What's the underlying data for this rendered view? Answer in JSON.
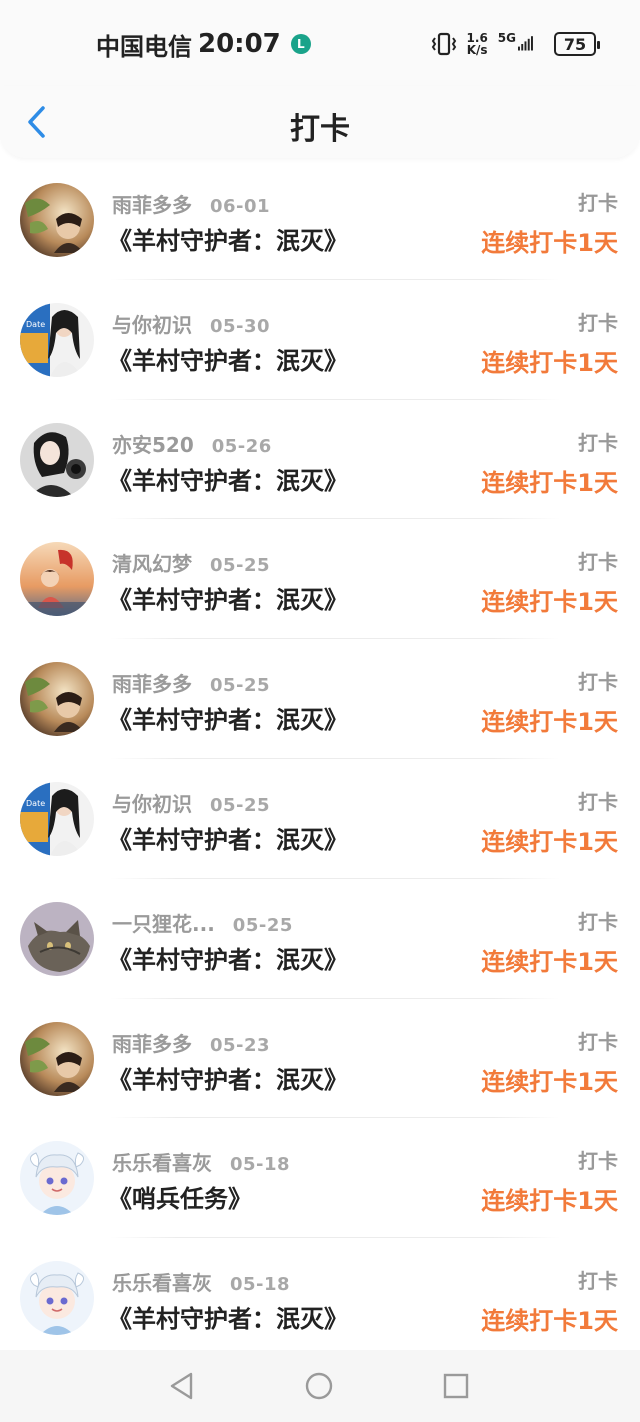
{
  "status_bar": {
    "carrier": "中国电信",
    "time": "20:07",
    "indicator": "L",
    "speed_value": "1.6",
    "speed_unit": "K/s",
    "network": "5G",
    "battery": "75"
  },
  "header": {
    "title": "打卡",
    "back_icon": "chevron-left-icon"
  },
  "colors": {
    "accent": "#f27a3a",
    "back": "#2e8ce6",
    "indicator": "#1aa38a"
  },
  "list": [
    {
      "name": "雨菲多多",
      "date": "06-01",
      "book": "《羊村守护者：泯灭》",
      "label": "打卡",
      "streak": "连续打卡1天",
      "avatar": "avatar-1"
    },
    {
      "name": "与你初识",
      "date": "05-30",
      "book": "《羊村守护者：泯灭》",
      "label": "打卡",
      "streak": "连续打卡1天",
      "avatar": "avatar-2"
    },
    {
      "name": "亦安520",
      "date": "05-26",
      "book": "《羊村守护者：泯灭》",
      "label": "打卡",
      "streak": "连续打卡1天",
      "avatar": "avatar-3"
    },
    {
      "name": "清风幻梦",
      "date": "05-25",
      "book": "《羊村守护者：泯灭》",
      "label": "打卡",
      "streak": "连续打卡1天",
      "avatar": "avatar-4"
    },
    {
      "name": "雨菲多多",
      "date": "05-25",
      "book": "《羊村守护者：泯灭》",
      "label": "打卡",
      "streak": "连续打卡1天",
      "avatar": "avatar-1"
    },
    {
      "name": "与你初识",
      "date": "05-25",
      "book": "《羊村守护者：泯灭》",
      "label": "打卡",
      "streak": "连续打卡1天",
      "avatar": "avatar-2"
    },
    {
      "name": "一只狸花...",
      "date": "05-25",
      "book": "《羊村守护者：泯灭》",
      "label": "打卡",
      "streak": "连续打卡1天",
      "avatar": "avatar-5"
    },
    {
      "name": "雨菲多多",
      "date": "05-23",
      "book": "《羊村守护者：泯灭》",
      "label": "打卡",
      "streak": "连续打卡1天",
      "avatar": "avatar-1"
    },
    {
      "name": "乐乐看喜灰",
      "date": "05-18",
      "book": "《哨兵任务》",
      "label": "打卡",
      "streak": "连续打卡1天",
      "avatar": "avatar-6"
    },
    {
      "name": "乐乐看喜灰",
      "date": "05-18",
      "book": "《羊村守护者：泯灭》",
      "label": "打卡",
      "streak": "连续打卡1天",
      "avatar": "avatar-6"
    }
  ],
  "nav_bar": {
    "back": "triangle-back-icon",
    "home": "circle-home-icon",
    "recent": "square-recent-icon"
  }
}
